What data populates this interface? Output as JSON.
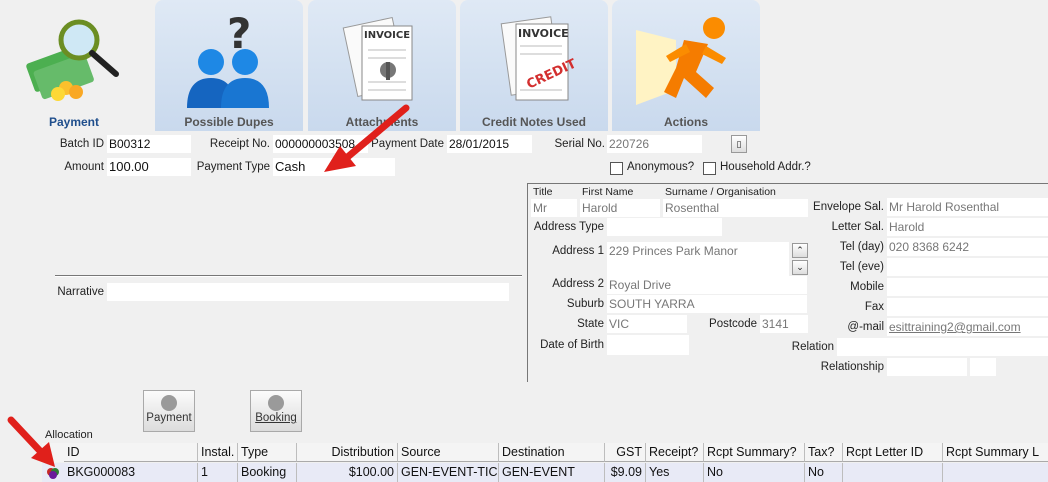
{
  "tabs": [
    {
      "label": "Payment",
      "icon": "money-magnifier-icon"
    },
    {
      "label": "Possible Dupes",
      "icon": "users-question-icon"
    },
    {
      "label": "Attachments",
      "icon": "attached-documents-icon"
    },
    {
      "label": "Credit Notes Used",
      "icon": "invoice-credit-icon"
    },
    {
      "label": "Actions",
      "icon": "running-man-icon"
    }
  ],
  "payment": {
    "batch_id_label": "Batch ID",
    "batch_id": "B00312",
    "receipt_no_label": "Receipt No.",
    "receipt_no": "000000003508",
    "payment_date_label": "Payment Date",
    "payment_date": "28/01/2015",
    "serial_no_label": "Serial No.",
    "serial_no": "220726",
    "amount_label": "Amount",
    "amount": "100.00",
    "payment_type_label": "Payment Type",
    "payment_type": "Cash",
    "anonymous_label": "Anonymous?",
    "household_label": "Household Addr.?",
    "narrative_label": "Narrative",
    "narrative": ""
  },
  "contact": {
    "title_label": "Title",
    "title": "Mr",
    "first_name_label": "First Name",
    "first_name": "Harold",
    "surname_label": "Surname / Organisation",
    "surname": "Rosenthal",
    "address_type_label": "Address Type",
    "address_type": "",
    "address1_label": "Address 1",
    "address1": "229 Princes Park Manor",
    "address2_label": "Address 2",
    "address2": "Royal Drive",
    "suburb_label": "Suburb",
    "suburb": "SOUTH YARRA",
    "state_label": "State",
    "state": "VIC",
    "postcode_label": "Postcode",
    "postcode": "3141",
    "dob_label": "Date of Birth",
    "dob": "",
    "envelope_sal_label": "Envelope Sal.",
    "envelope_sal": "Mr Harold Rosenthal",
    "letter_sal_label": "Letter Sal.",
    "letter_sal": "Harold",
    "tel_day_label": "Tel (day)",
    "tel_day": "020 8368 6242",
    "tel_eve_label": "Tel (eve)",
    "tel_eve": "",
    "mobile_label": "Mobile",
    "mobile": "",
    "fax_label": "Fax",
    "fax": "",
    "email_label": "@-mail",
    "email": "esittraining2@gmail.com",
    "relation_label": "Relation",
    "relation": "",
    "relationship_label": "Relationship",
    "relationship": ""
  },
  "buttons": {
    "payment": "Payment",
    "booking": "Booking"
  },
  "allocation": {
    "label": "Allocation",
    "columns": [
      "ID",
      "Instal.",
      "Type",
      "Distribution",
      "Source",
      "Destination",
      "GST",
      "Receipt?",
      "Rcpt Summary?",
      "Tax?",
      "Rcpt Letter ID",
      "Rcpt Summary L"
    ],
    "rows": [
      [
        "BKG000083",
        "1",
        "Booking",
        "$100.00",
        "GEN-EVENT-TIC",
        "GEN-EVENT",
        "$9.09",
        "Yes",
        "No",
        "No",
        "",
        ""
      ]
    ]
  },
  "colors": {
    "accent": "#1f4e8c",
    "arrow": "#e0201b"
  }
}
